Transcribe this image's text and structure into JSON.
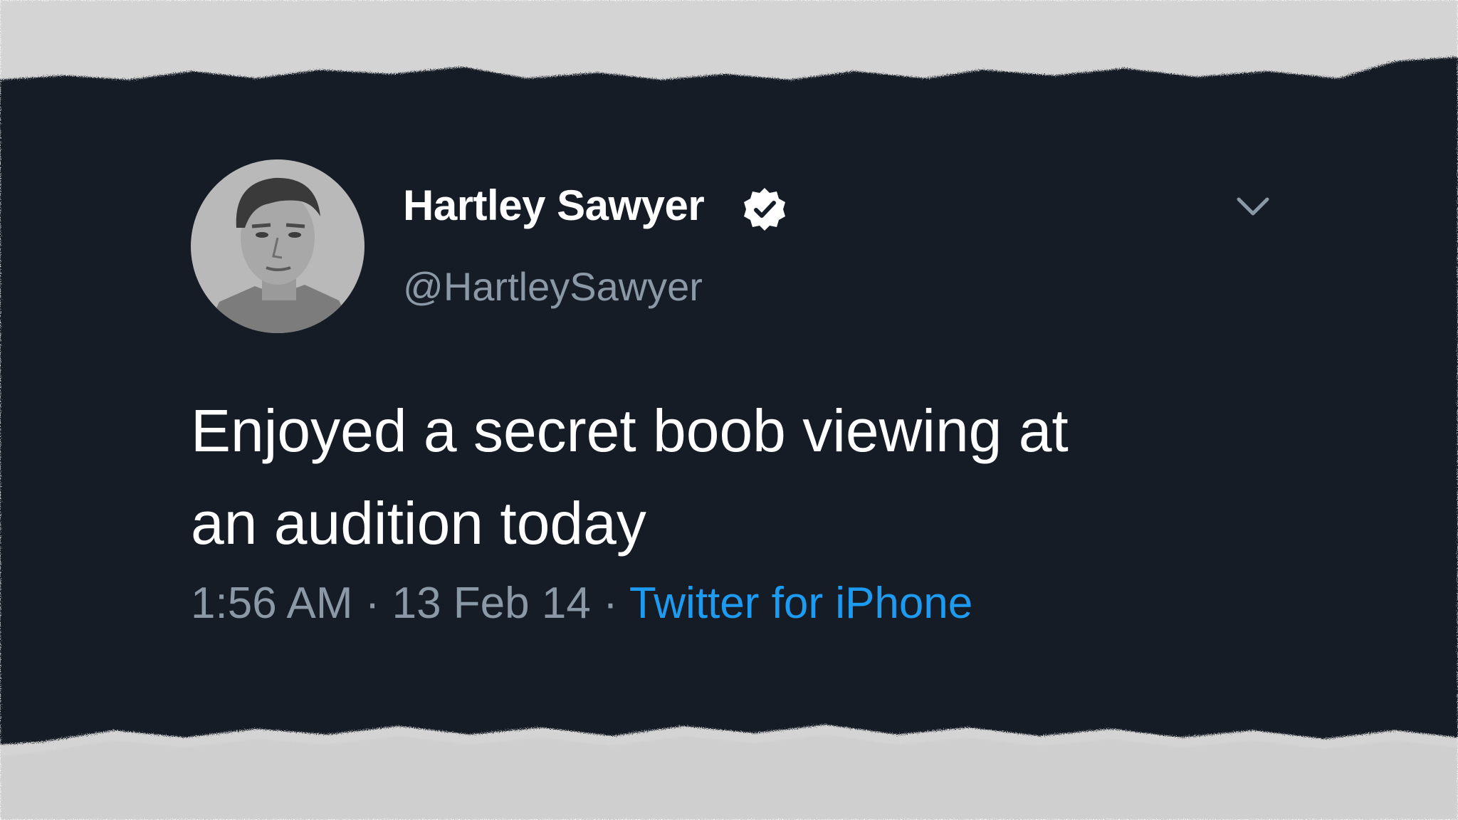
{
  "tweet": {
    "display_name": "Hartley Sawyer",
    "handle": "@HartleySawyer",
    "verified": true,
    "text_lines": [
      "Enjoyed a secret boob viewing at",
      "an audition today"
    ],
    "time": "1:56 AM",
    "separator": "·",
    "date": "13 Feb 14",
    "source": "Twitter for iPhone"
  },
  "icons": {
    "verified": "verified-badge-icon",
    "menu": "chevron-down-icon",
    "avatar": "profile-photo"
  },
  "colors": {
    "background": "#151c26",
    "name": "#ffffff",
    "secondary": "#8b98a5",
    "link": "#1d9bf0",
    "paper": "#ffffff"
  }
}
